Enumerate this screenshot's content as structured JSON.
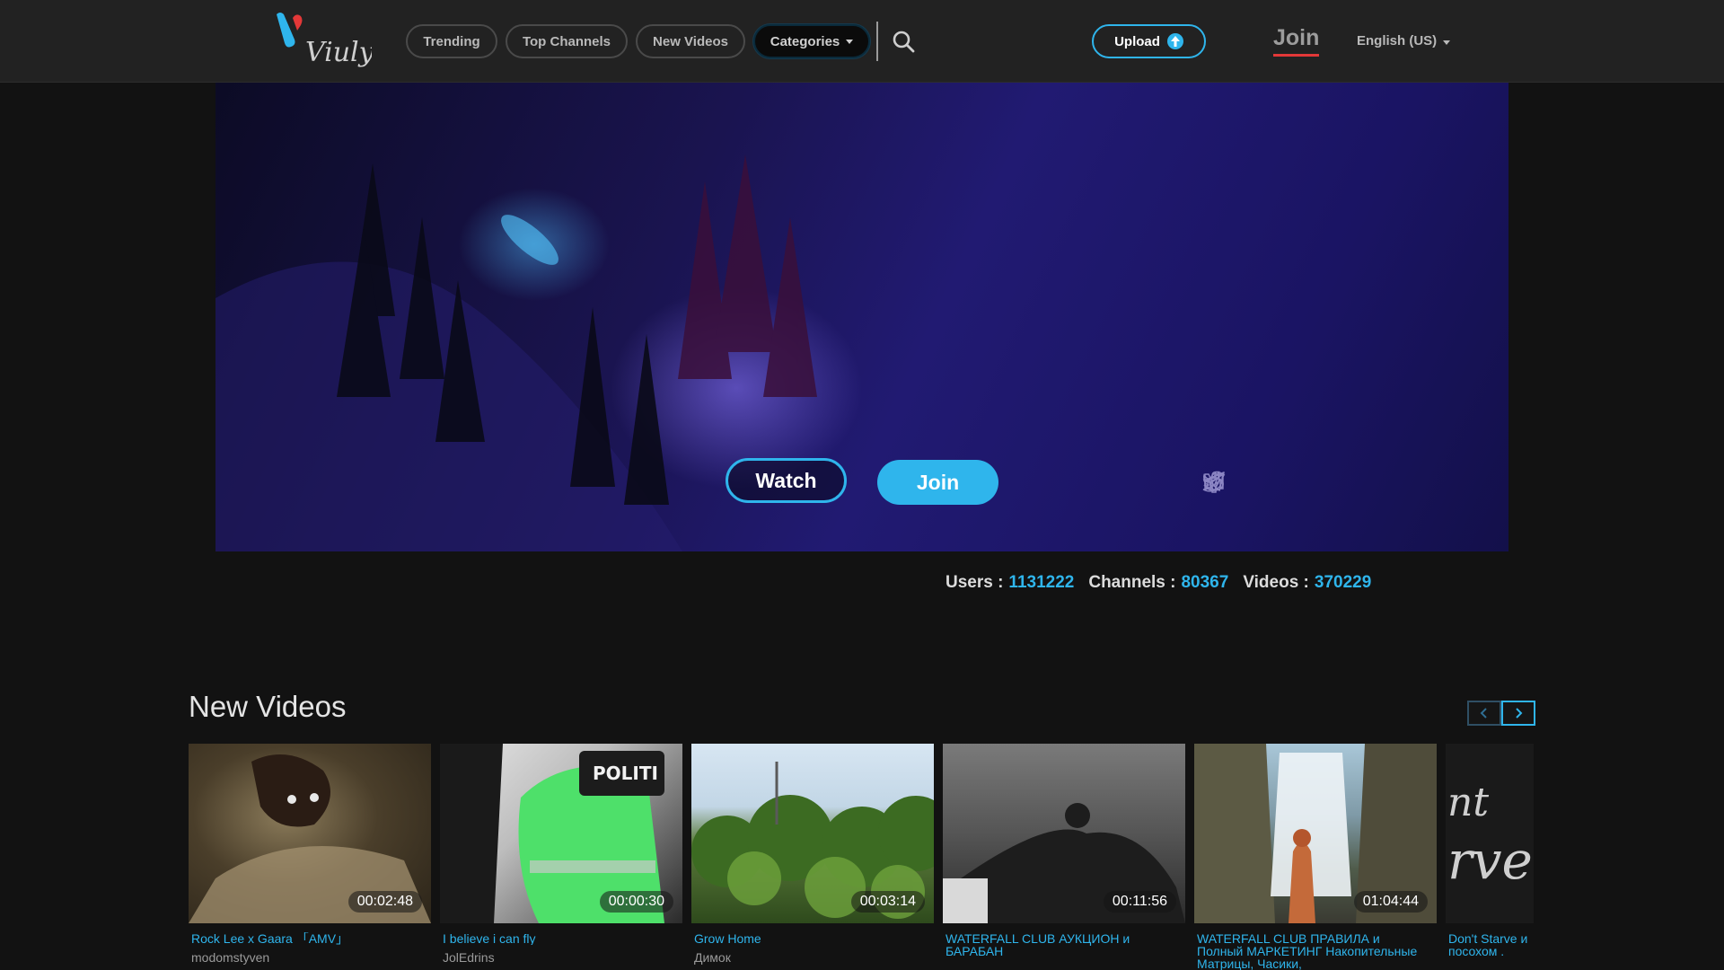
{
  "header": {
    "logo_text": "Viuly",
    "nav": [
      "Trending",
      "Top Channels",
      "New Videos",
      "Categories"
    ],
    "upload_label": "Upload",
    "join_label": "Join",
    "language": "English (US)"
  },
  "hero": {
    "watch_label": "Watch",
    "join_label": "Join",
    "social_icons": [
      "reddit-icon",
      "telegram-icon",
      "facebook-icon",
      "twitter-icon",
      "medium-icon"
    ]
  },
  "stats": {
    "users_label": "Users :",
    "users_value": "1131222",
    "channels_label": "Channels :",
    "channels_value": "80367",
    "videos_label": "Videos :",
    "videos_value": "370229"
  },
  "new_videos": {
    "title": "New Videos",
    "items": [
      {
        "title": "Rock Lee x Gaara 「AMV」",
        "channel": "modomstyven",
        "duration": "00:02:48"
      },
      {
        "title": "I believe i can fly",
        "channel": "JolEdrins",
        "duration": "00:00:30"
      },
      {
        "title": "Grow Home",
        "channel": "Димок",
        "duration": "00:03:14"
      },
      {
        "title": "WATERFALL CLUB АУКЦИОН и БАРАБАН",
        "channel": "",
        "duration": "00:11:56"
      },
      {
        "title": "WATERFALL CLUB ПРАВИЛА и Полный МАРКЕТИНГ Накопительные Матрицы, Часики,",
        "channel": "",
        "duration": "01:04:44"
      },
      {
        "title": "Don't Starve и посохом .",
        "channel": "",
        "duration": ""
      }
    ]
  },
  "colors": {
    "accent": "#2fb5ec",
    "join_underline": "#e33838",
    "background": "#121212",
    "header": "#222222"
  }
}
